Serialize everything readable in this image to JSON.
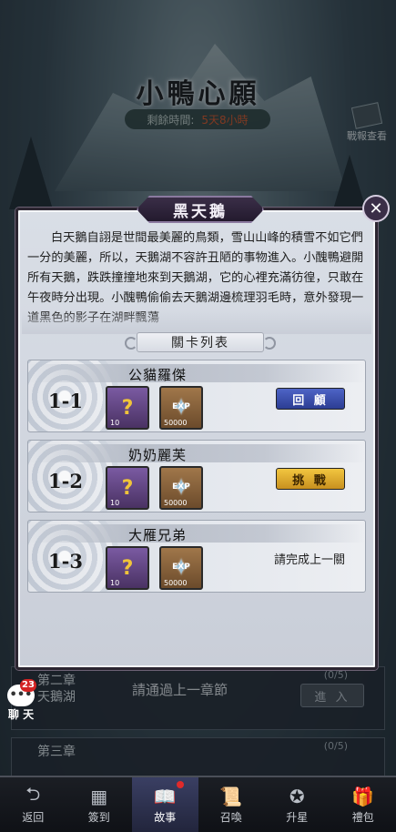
{
  "event": {
    "title": "小鴨心願",
    "time_label": "剩餘時間:",
    "time_value": "5天8小時",
    "battle_log_label": "戰報查看"
  },
  "dialog": {
    "title": "黑天鵝",
    "close_icon": "close-icon",
    "story": "白天鵝自詡是世間最美麗的鳥類，雪山山峰的積雪不如它們一分的美麗，所以，天鵝湖不容許丑陋的事物進入。小醜鴨避開所有天鵝，跌跌撞撞地來到天鵝湖，它的心裡充滿彷徨，只敢在午夜時分出現。小醜鴨偷偷去天鵝湖邊梳理羽毛時，意外發現一道黑色的影子在湖畔飄蕩",
    "level_list_header": "關卡列表",
    "levels": [
      {
        "num": "1-1",
        "name": "公貓羅傑",
        "mystery_qty": "10",
        "exp_label": "EXP",
        "exp_qty": "50000",
        "action_type": "button",
        "action_label": "回 顧",
        "action_style": "review"
      },
      {
        "num": "1-2",
        "name": "奶奶麗芙",
        "mystery_qty": "10",
        "exp_label": "EXP",
        "exp_qty": "50000",
        "action_type": "button",
        "action_label": "挑 戰",
        "action_style": "challenge"
      },
      {
        "num": "1-3",
        "name": "大雁兄弟",
        "mystery_qty": "10",
        "exp_label": "EXP",
        "exp_qty": "50000",
        "action_type": "text",
        "action_label": "請完成上一關",
        "action_style": "locked"
      }
    ]
  },
  "chapters": [
    {
      "title_line1": "第二章",
      "title_line2": "天鵝湖",
      "message": "請通過上一章節",
      "progress": "(0/5)",
      "enter_label": "進 入"
    },
    {
      "title_line1": "第三章",
      "title_line2": "",
      "message": "",
      "progress": "(0/5)",
      "enter_label": ""
    }
  ],
  "chat": {
    "badge": "23",
    "label": "聊 天"
  },
  "nav": [
    {
      "label": "返回",
      "icon": "back-arrow-icon",
      "glyph": "⮌",
      "active": false
    },
    {
      "label": "簽到",
      "icon": "calendar-icon",
      "glyph": "▦",
      "active": false
    },
    {
      "label": "故事",
      "icon": "book-icon",
      "glyph": "📖",
      "active": true
    },
    {
      "label": "召喚",
      "icon": "scroll-icon",
      "glyph": "📜",
      "active": false
    },
    {
      "label": "升星",
      "icon": "star-badge-icon",
      "glyph": "✪",
      "active": false
    },
    {
      "label": "禮包",
      "icon": "gift-icon",
      "glyph": "🎁",
      "active": false
    }
  ],
  "colors": {
    "review_button": "#2c3d93",
    "challenge_button": "#f2c640",
    "time_value": "#e05a2a",
    "notification_dot": "#e02a2a"
  }
}
